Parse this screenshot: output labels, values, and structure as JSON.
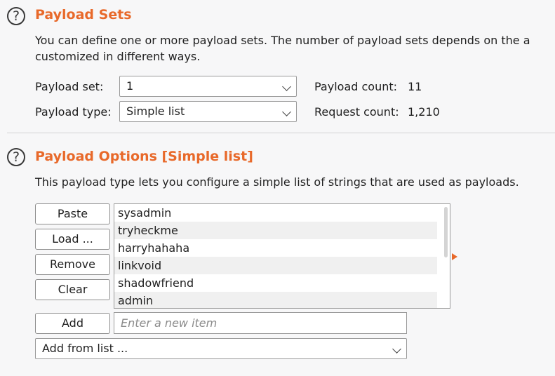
{
  "payload_sets": {
    "title": "Payload Sets",
    "description_line1": "You can define one or more payload sets. The number of payload sets depends on the a",
    "description_line2": "customized in different ways.",
    "payload_set_label": "Payload set:",
    "payload_set_value": "1",
    "payload_type_label": "Payload type:",
    "payload_type_value": "Simple list",
    "payload_count_label": "Payload count:",
    "payload_count_value": "11",
    "request_count_label": "Request count:",
    "request_count_value": "1,210"
  },
  "payload_options": {
    "title": "Payload Options [Simple list]",
    "description": "This payload type lets you configure a simple list of strings that are used as payloads.",
    "buttons": {
      "paste": "Paste",
      "load": "Load ...",
      "remove": "Remove",
      "clear": "Clear",
      "add": "Add"
    },
    "items": [
      "sysadmin",
      "tryheckme",
      "harryhahaha",
      "linkvoid",
      "shadowfriend",
      "admin"
    ],
    "new_item_placeholder": "Enter a new item",
    "add_from_list": "Add from list ..."
  },
  "colors": {
    "accent": "#e8692a"
  }
}
